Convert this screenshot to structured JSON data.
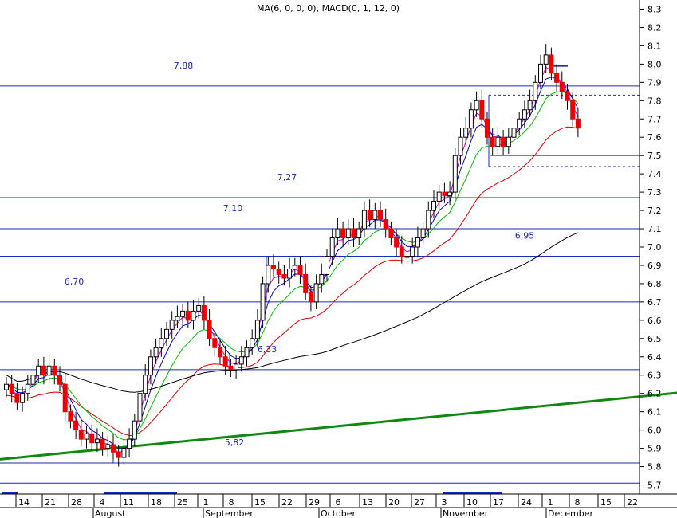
{
  "legend": "MA(6, 0, 0, 0), MACD(0, 1, 12, 0)",
  "chart_data": {
    "type": "candlestick",
    "y_axis": {
      "min": 5.65,
      "max": 8.35,
      "ticks": [
        "5.7",
        "5.8",
        "5.9",
        "6.0",
        "6.1",
        "6.2",
        "6.3",
        "6.4",
        "6.5",
        "6.6",
        "6.7",
        "6.8",
        "6.9",
        "7.0",
        "7.1",
        "7.2",
        "7.3",
        "7.4",
        "7.5",
        "7.6",
        "7.7",
        "7.8",
        "7.9",
        "8.0",
        "8.1",
        "8.2",
        "8.3"
      ],
      "position": "right"
    },
    "x_axis": {
      "day_ticks": [
        "14",
        "21",
        "28",
        "4",
        "11",
        "18",
        "25",
        "1",
        "8",
        "15",
        "22",
        "29",
        "6",
        "13",
        "20",
        "27",
        "3",
        "10",
        "17",
        "24",
        "1",
        "8",
        "15",
        "22"
      ],
      "months": [
        "August",
        "September",
        "October",
        "November",
        "December"
      ]
    },
    "level_lines": [
      {
        "value": 7.88,
        "label": "7,88"
      },
      {
        "value": 7.27,
        "label": "7,27"
      },
      {
        "value": 7.1,
        "label": "7,10"
      },
      {
        "value": 6.95,
        "label": "6,95"
      },
      {
        "value": 6.7,
        "label": "6,70"
      },
      {
        "value": 6.33,
        "label": "6,33"
      },
      {
        "value": 5.82,
        "label": "5,82"
      },
      {
        "value": 5.71,
        "label": ""
      },
      {
        "value": 7.5,
        "label": ""
      }
    ],
    "dashed_levels": [
      7.83,
      7.44
    ],
    "trendline": {
      "from": [
        0,
        5.84
      ],
      "to": [
        135,
        6.23
      ],
      "color": "#118811"
    },
    "closes": [
      6.25,
      6.2,
      6.15,
      6.2,
      6.25,
      6.3,
      6.35,
      6.3,
      6.35,
      6.3,
      6.25,
      6.1,
      6.05,
      6.0,
      5.95,
      5.98,
      5.93,
      5.95,
      5.9,
      5.92,
      5.88,
      5.85,
      5.9,
      5.95,
      6.05,
      6.2,
      6.3,
      6.4,
      6.45,
      6.5,
      6.55,
      6.6,
      6.62,
      6.65,
      6.6,
      6.65,
      6.68,
      6.6,
      6.5,
      6.45,
      6.4,
      6.35,
      6.33,
      6.36,
      6.4,
      6.45,
      6.5,
      6.6,
      6.8,
      6.9,
      6.88,
      6.85,
      6.83,
      6.88,
      6.9,
      6.85,
      6.75,
      6.7,
      6.8,
      6.85,
      6.95,
      7.05,
      7.1,
      7.05,
      7.1,
      7.05,
      7.1,
      7.2,
      7.15,
      7.2,
      7.15,
      7.1,
      7.05,
      7.0,
      6.95,
      6.95,
      7.0,
      7.05,
      7.1,
      7.2,
      7.25,
      7.3,
      7.28,
      7.3,
      7.5,
      7.6,
      7.65,
      7.75,
      7.8,
      7.7,
      7.6,
      7.55,
      7.6,
      7.55,
      7.6,
      7.65,
      7.7,
      7.75,
      7.8,
      7.9,
      8.0,
      8.05,
      7.95,
      7.9,
      7.85,
      7.8,
      7.7,
      7.65
    ],
    "series": [
      {
        "values": [],
        "color": "#dd0000"
      },
      {
        "values": [],
        "color": "#00bb00"
      },
      {
        "values": [],
        "color": "#0000cc"
      },
      {
        "values": [],
        "color": "#cc00cc"
      },
      {
        "values": [],
        "color": "#000000"
      }
    ]
  }
}
